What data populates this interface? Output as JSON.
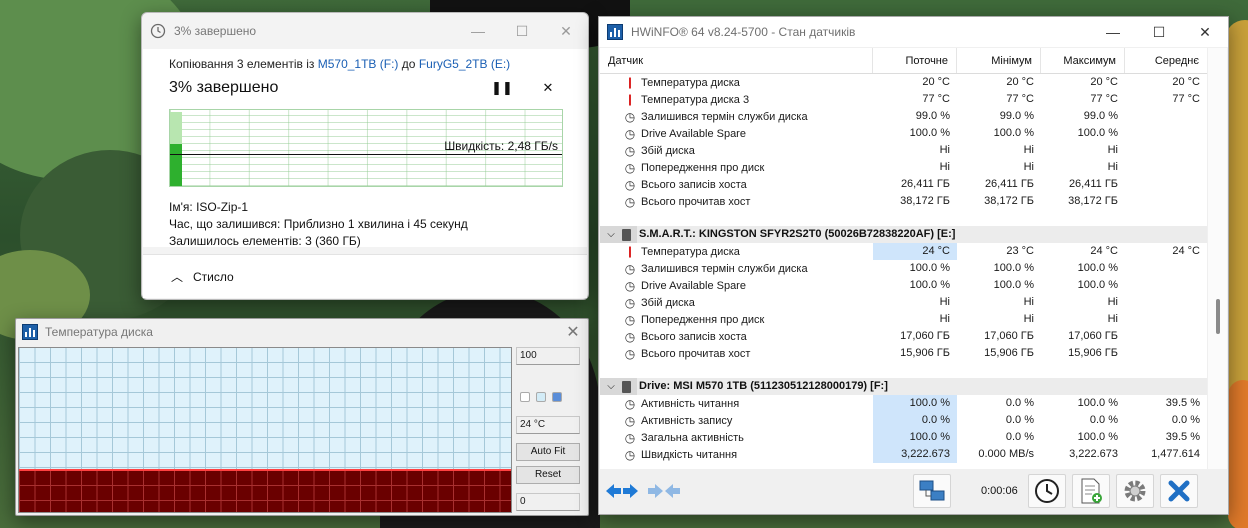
{
  "copy_dialog": {
    "title": "3% завершено",
    "copying_prefix": "Копіювання 3 елементів із",
    "source": "M570_1TB (F:)",
    "to_word": "до",
    "destination": "FuryG5_2TB (E:)",
    "percent_label": "3% завершено",
    "pause_icon": "pause-icon",
    "stop_icon": "close-icon",
    "progress": 0.03,
    "speed": "Швидкість: 2,48 ГБ/s",
    "name_label": "Ім'я:",
    "name_value": "ISO-Zip-1",
    "time_label": "Час, що залишився:",
    "time_value": "Приблизно 1 хвилина і 45 секунд",
    "items_label": "Залишилось елементів:",
    "items_value": "3 (360 ГБ)",
    "collapse_label": "Стисло",
    "colors": {
      "graph_fill": "#2eb02e",
      "link": "#1a5fb4"
    }
  },
  "temp_graph": {
    "title": "Температура диска",
    "max_value": "100",
    "current_value": "24 °C",
    "autofit_label": "Auto Fit",
    "reset_label": "Reset",
    "min_value": "0",
    "colors": {
      "plot_bg": "#dff2fb",
      "lower_band": "#6a0000",
      "trace": "#ff4040"
    }
  },
  "hwinfo": {
    "title": "HWiNFO® 64 v8.24-5700 - Стан датчиків",
    "columns": [
      "Датчик",
      "Поточне",
      "Мінімум",
      "Максимум",
      "Середнє"
    ],
    "group1_rows": [
      {
        "icon": "thermometer-icon",
        "name": "Температура диска",
        "cur": "20 °C",
        "min": "20 °C",
        "max": "20 °C",
        "avg": "20 °C"
      },
      {
        "icon": "thermometer-icon",
        "name": "Температура диска 3",
        "cur": "77 °C",
        "min": "77 °C",
        "max": "77 °C",
        "avg": "77 °C"
      },
      {
        "icon": "clock-icon",
        "name": "Залишився термін служби диска",
        "cur": "99.0 %",
        "min": "99.0 %",
        "max": "99.0 %",
        "avg": ""
      },
      {
        "icon": "clock-icon",
        "name": "Drive Available Spare",
        "cur": "100.0 %",
        "min": "100.0 %",
        "max": "100.0 %",
        "avg": ""
      },
      {
        "icon": "clock-icon",
        "name": "Збій диска",
        "cur": "Ні",
        "min": "Ні",
        "max": "Ні",
        "avg": ""
      },
      {
        "icon": "clock-icon",
        "name": "Попередження про диск",
        "cur": "Ні",
        "min": "Ні",
        "max": "Ні",
        "avg": ""
      },
      {
        "icon": "clock-icon",
        "name": "Всього записів хоста",
        "cur": "26,411 ГБ",
        "min": "26,411 ГБ",
        "max": "26,411 ГБ",
        "avg": ""
      },
      {
        "icon": "clock-icon",
        "name": "Всього прочитав хост",
        "cur": "38,172 ГБ",
        "min": "38,172 ГБ",
        "max": "38,172 ГБ",
        "avg": ""
      }
    ],
    "section2_title": "S.M.A.R.T.: KINGSTON SFYR2S2T0 (50026B72838220AF) [E:]",
    "group2_rows": [
      {
        "icon": "thermometer-icon",
        "name": "Температура диска",
        "cur": "24 °C",
        "min": "23 °C",
        "max": "24 °C",
        "avg": "24 °C"
      },
      {
        "icon": "clock-icon",
        "name": "Залишився термін служби диска",
        "cur": "100.0 %",
        "min": "100.0 %",
        "max": "100.0 %",
        "avg": ""
      },
      {
        "icon": "clock-icon",
        "name": "Drive Available Spare",
        "cur": "100.0 %",
        "min": "100.0 %",
        "max": "100.0 %",
        "avg": ""
      },
      {
        "icon": "clock-icon",
        "name": "Збій диска",
        "cur": "Ні",
        "min": "Ні",
        "max": "Ні",
        "avg": ""
      },
      {
        "icon": "clock-icon",
        "name": "Попередження про диск",
        "cur": "Ні",
        "min": "Ні",
        "max": "Ні",
        "avg": ""
      },
      {
        "icon": "clock-icon",
        "name": "Всього записів хоста",
        "cur": "17,060 ГБ",
        "min": "17,060 ГБ",
        "max": "17,060 ГБ",
        "avg": ""
      },
      {
        "icon": "clock-icon",
        "name": "Всього прочитав хост",
        "cur": "15,906 ГБ",
        "min": "15,906 ГБ",
        "max": "15,906 ГБ",
        "avg": ""
      }
    ],
    "section3_title": "Drive: MSI M570 1TB (511230512128000179) [F:]",
    "group3_rows": [
      {
        "icon": "clock-icon",
        "name": "Активність читання",
        "cur": "100.0 %",
        "min": "0.0 %",
        "max": "100.0 %",
        "avg": "39.5 %"
      },
      {
        "icon": "clock-icon",
        "name": "Активність запису",
        "cur": "0.0 %",
        "min": "0.0 %",
        "max": "0.0 %",
        "avg": "0.0 %"
      },
      {
        "icon": "clock-icon",
        "name": "Загальна активність",
        "cur": "100.0 %",
        "min": "0.0 %",
        "max": "100.0 %",
        "avg": "39.5 %"
      },
      {
        "icon": "clock-icon",
        "name": "Швидкість читання",
        "cur": "3,222.673",
        "min": "0.000 MB/s",
        "max": "3,222.673",
        "avg": "1,477.614"
      }
    ],
    "elapsed": "0:00:06",
    "colors": {
      "highlight": "#cfe5fb",
      "section_bg": "#d8d8d8",
      "thermo": "#d81010"
    }
  }
}
